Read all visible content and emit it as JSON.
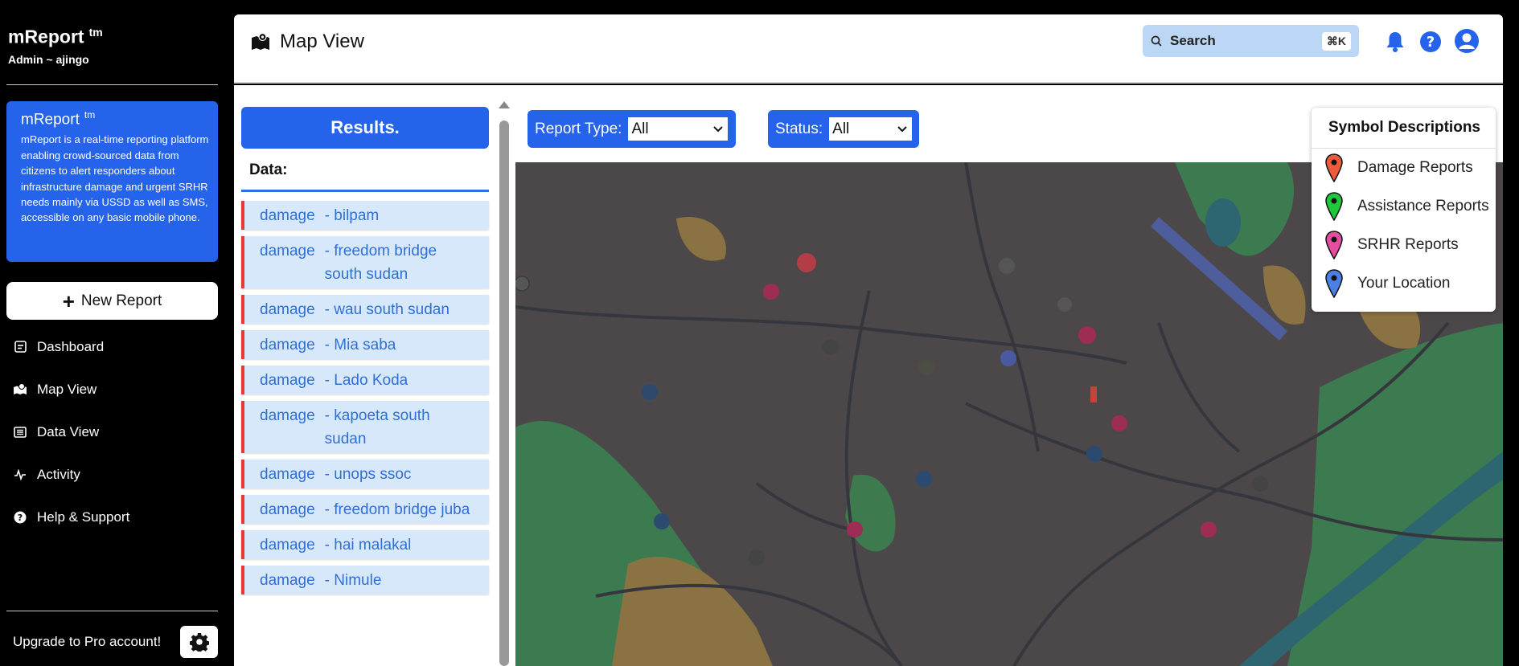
{
  "sidebar": {
    "brand": "mReport",
    "brand_tm": "tm",
    "user": "Admin ~ ajingo",
    "info_title": "mReport",
    "info_tm": "tm",
    "info_desc": "mReport is a real-time reporting platform enabling crowd-sourced data from citizens to alert responders about infrastructure damage and urgent SRHR needs mainly via USSD as well as SMS, accessible on any basic mobile phone.",
    "new_report": "New Report",
    "nav": [
      {
        "label": "Dashboard",
        "icon": "dashboard-icon"
      },
      {
        "label": "Map View",
        "icon": "map-icon"
      },
      {
        "label": "Data View",
        "icon": "list-icon"
      },
      {
        "label": "Activity",
        "icon": "activity-icon"
      },
      {
        "label": "Help & Support",
        "icon": "help-icon"
      }
    ],
    "upgrade": "Upgrade to Pro account!"
  },
  "header": {
    "title": "Map View",
    "search_label": "Search",
    "shortcut": "⌘K"
  },
  "results": {
    "button": "Results.",
    "data_label": "Data:",
    "items": [
      {
        "type": "damage",
        "name": "- bilpam"
      },
      {
        "type": "damage",
        "name": "- freedom bridge south sudan"
      },
      {
        "type": "damage",
        "name": "- wau south sudan"
      },
      {
        "type": "damage",
        "name": "- Mia saba"
      },
      {
        "type": "damage",
        "name": "- Lado Koda"
      },
      {
        "type": "damage",
        "name": "- kapoeta south sudan"
      },
      {
        "type": "damage",
        "name": "- unops ssoc"
      },
      {
        "type": "damage",
        "name": "- freedom bridge juba"
      },
      {
        "type": "damage",
        "name": "- hai malakal"
      },
      {
        "type": "damage",
        "name": "- Nimule"
      }
    ]
  },
  "filters": {
    "report_type_label": "Report Type:",
    "report_type_value": "All",
    "status_label": "Status:",
    "status_value": "All"
  },
  "legend": {
    "title": "Symbol Descriptions",
    "items": [
      {
        "label": "Damage Reports",
        "color": "#f05a3c"
      },
      {
        "label": "Assistance Reports",
        "color": "#1ec93c"
      },
      {
        "label": "SRHR Reports",
        "color": "#e64ca0"
      },
      {
        "label": "Your Location",
        "color": "#4a7fe6"
      }
    ]
  },
  "colors": {
    "accent": "#2563eb",
    "damage": "#e53935"
  }
}
